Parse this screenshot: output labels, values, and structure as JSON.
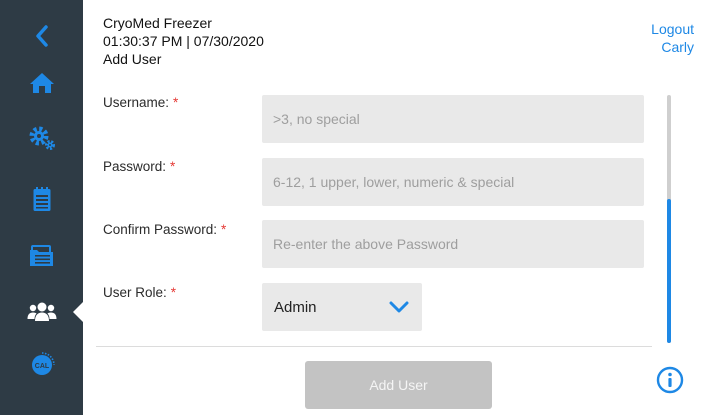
{
  "header": {
    "app_name": "CryoMed Freezer",
    "datetime": "01:30:37 PM | 07/30/2020",
    "page_title": "Add User"
  },
  "account": {
    "logout_label": "Logout",
    "user_name": "Carly"
  },
  "sidebar": {
    "background": "#2e3b45",
    "icon_color": "#1e88e5",
    "items": [
      {
        "icon": "chevron-left-icon"
      },
      {
        "icon": "home-icon"
      },
      {
        "icon": "gears-icon"
      },
      {
        "icon": "notepad-icon"
      },
      {
        "icon": "folders-icon"
      },
      {
        "icon": "users-icon",
        "active": true
      },
      {
        "icon": "calibration-icon",
        "text": "CAL"
      }
    ]
  },
  "form": {
    "required_marker": "*",
    "username": {
      "label": "Username:",
      "value": "",
      "placeholder": ">3, no special"
    },
    "password": {
      "label": "Password:",
      "value": "",
      "placeholder": "6-12, 1 upper, lower, numeric & special"
    },
    "confirm_password": {
      "label": "Confirm Password:",
      "value": "",
      "placeholder": "Re-enter the above Password"
    },
    "user_role": {
      "label": "User Role:",
      "selected": "Admin"
    },
    "submit_label": "Add User"
  },
  "colors": {
    "accent": "#1e88e5",
    "required": "#e53935",
    "input_bg": "#e9e9e9",
    "button_disabled": "#c3c3c3"
  }
}
